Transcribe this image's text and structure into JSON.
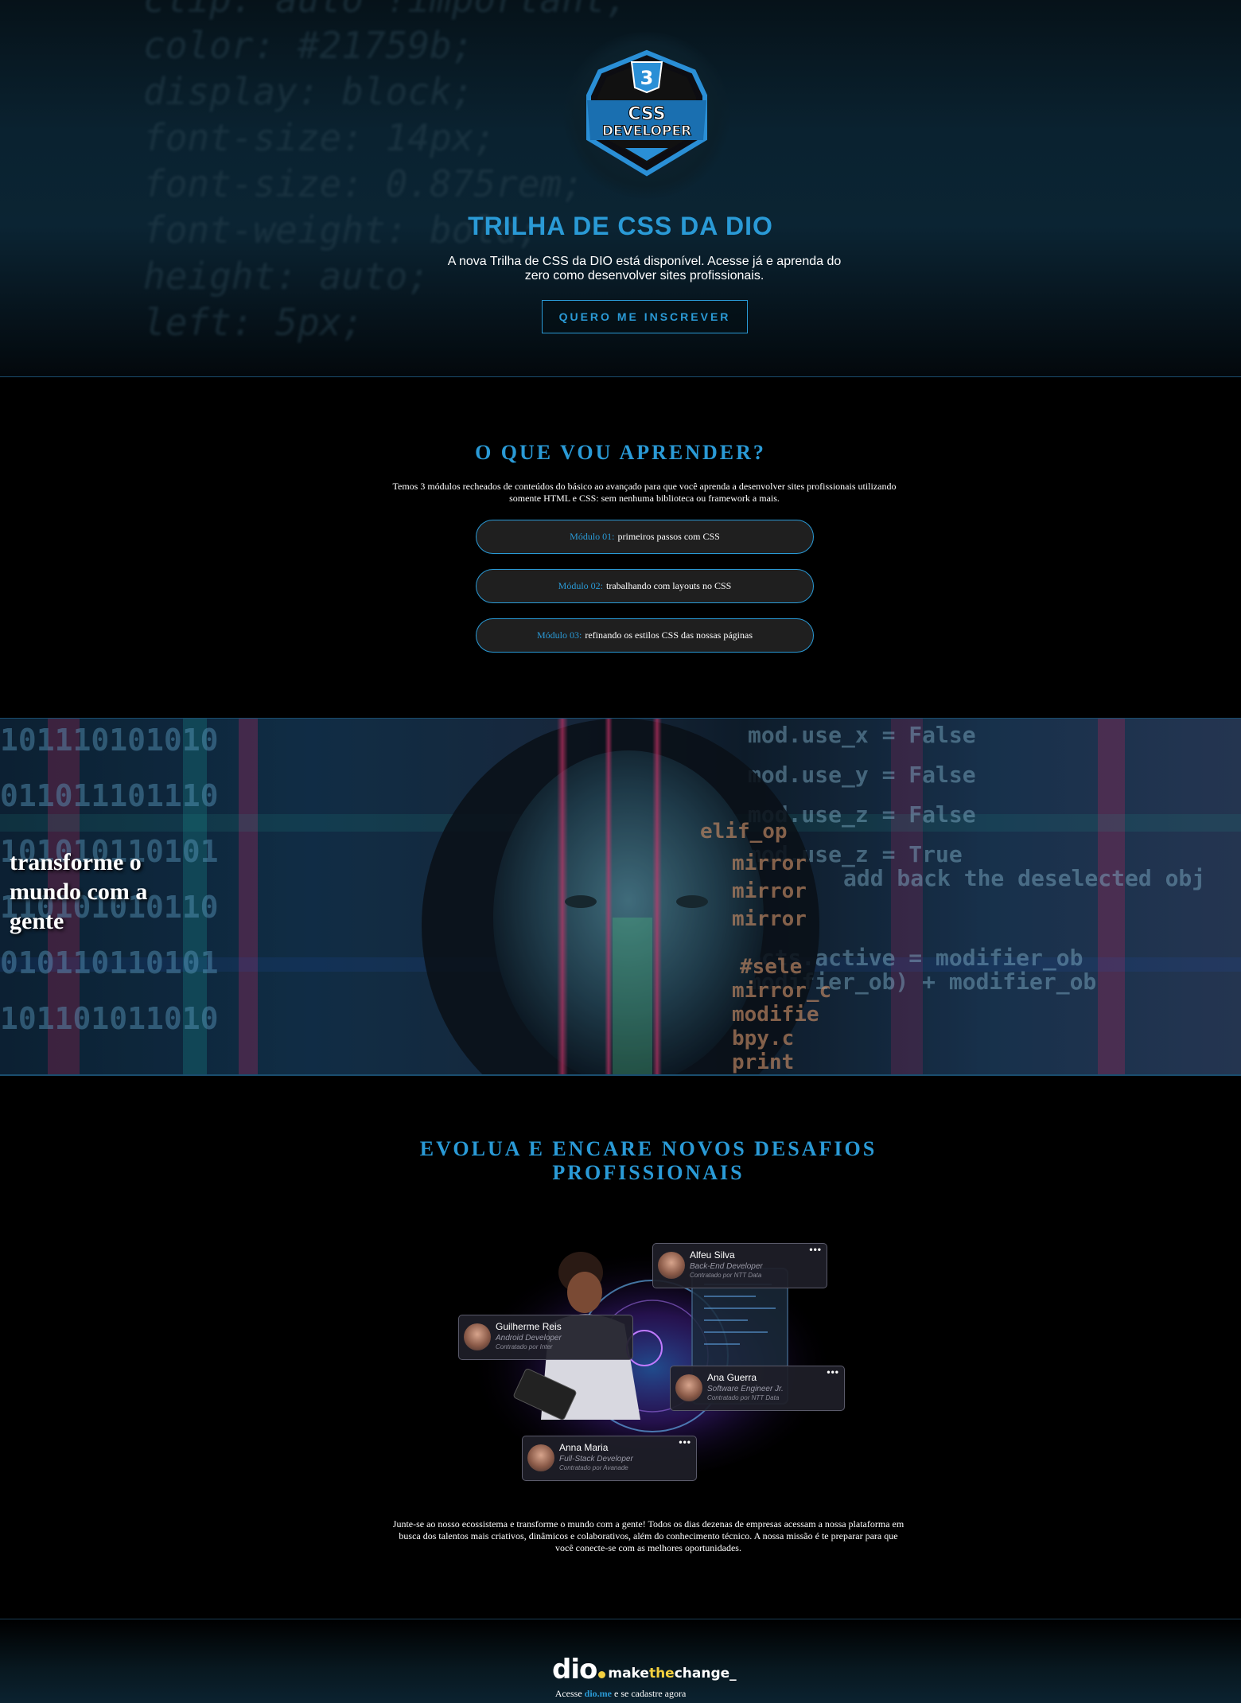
{
  "hero": {
    "badge_top": "3",
    "badge_line1": "CSS",
    "badge_line2": "DEVELOPER",
    "title": "TRILHA DE CSS DA DIO",
    "subtitle": "A nova Trilha de CSS da DIO está disponível. Acesse já e aprenda do zero como desenvolver sites profissionais.",
    "cta_label": "QUERO ME INSCREVER"
  },
  "learn": {
    "title": "O QUE VOU APRENDER?",
    "text": "Temos 3 módulos recheados de conteúdos do básico ao avançado para que você aprenda a desenvolver sites profissionais utilizando somente HTML e CSS: sem nenhuma biblioteca ou framework a mais.",
    "modules": [
      {
        "label": "Módulo 01:",
        "text": "primeiros passos com CSS"
      },
      {
        "label": "Módulo 02:",
        "text": "trabalhando com layouts no CSS"
      },
      {
        "label": "Módulo 03:",
        "text": "refinando os estilos CSS das nossas páginas"
      }
    ]
  },
  "banner": {
    "text": "transforme o mundo com a gente"
  },
  "evolve": {
    "title": "EVOLUA E ENCARE NOVOS DESAFIOS PROFISSIONAIS",
    "cards": [
      {
        "name": "Alfeu Silva",
        "role": "Back-End Developer",
        "hired": "Contratado por NTT Data"
      },
      {
        "name": "Guilherme Reis",
        "role": "Android Developer",
        "hired": "Contratado por Inter"
      },
      {
        "name": "Ana Guerra",
        "role": "Software Engineer Jr.",
        "hired": "Contratado por NTT Data"
      },
      {
        "name": "Anna Maria",
        "role": "Full-Stack Developer",
        "hired": "Contratado por Avanade"
      }
    ],
    "text": "Junte-se ao nosso ecossistema e transforme o mundo com a gente! Todos os dias dezenas de empresas acessam a nossa plataforma em busca dos talentos mais criativos, dinâmicos e colaborativos, além do conhecimento técnico. A nossa missão é te preparar para que você conecte-se com as melhores oportunidades."
  },
  "footer": {
    "logo_dio": "dio",
    "logo_make": "make",
    "logo_the": "the",
    "logo_change": "change_",
    "text_before": "Acesse",
    "link": "dio.me",
    "text_after": "e se cadastre agora"
  },
  "colors": {
    "accent": "#2a9ad6",
    "brand_yellow": "#f4d03f",
    "background": "#000000"
  }
}
